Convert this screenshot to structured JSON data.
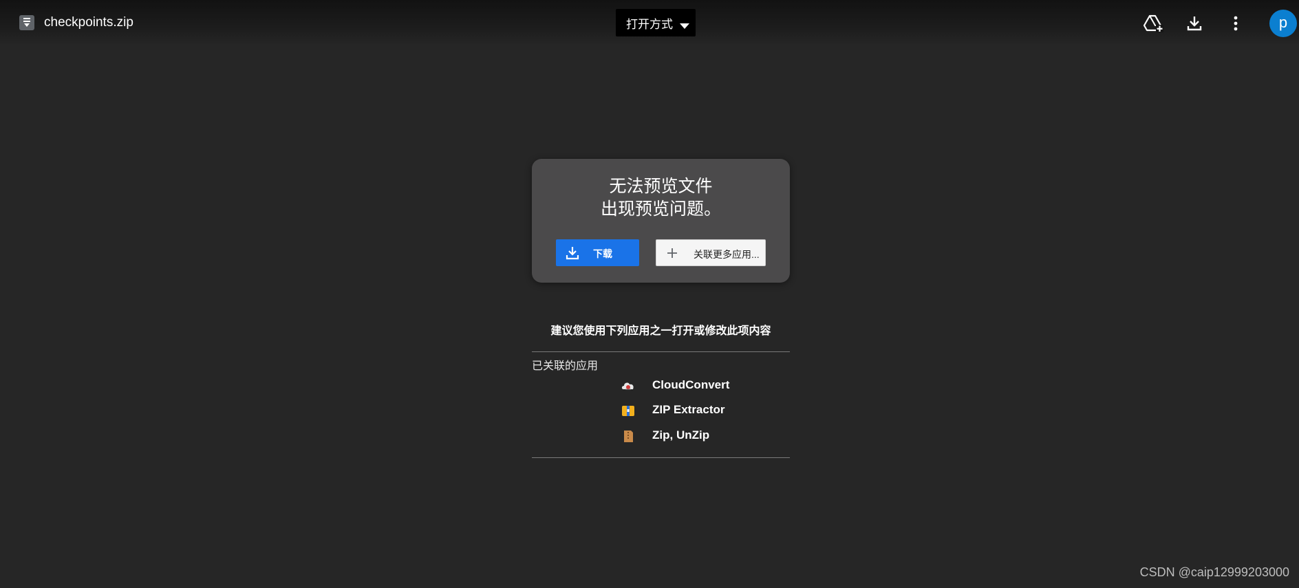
{
  "header": {
    "file_name": "checkpoints.zip",
    "open_with_label": "打开方式",
    "avatar_letter": "p",
    "icons": [
      "file-archive-icon",
      "add-to-drive-icon",
      "download-icon",
      "more-vert-icon"
    ]
  },
  "preview": {
    "title_line1": "无法预览文件",
    "title_line2": "出现预览问题。",
    "download_label": "下载",
    "connect_label": "关联更多应用..."
  },
  "suggest_text": "建议您使用下列应用之一打开或修改此项内容",
  "associated_label": "已关联的应用",
  "apps": [
    {
      "name": "CloudConvert",
      "icon": "cloudconvert-icon"
    },
    {
      "name": "ZIP Extractor",
      "icon": "zip-extractor-icon"
    },
    {
      "name": "Zip, UnZip",
      "icon": "zip-unzip-icon"
    }
  ],
  "watermark": "CSDN @caip12999203000",
  "colors": {
    "background": "#262626",
    "accent_blue": "#1a73e8",
    "avatar": "#0b7fd0",
    "card": "#4b4a4b"
  }
}
